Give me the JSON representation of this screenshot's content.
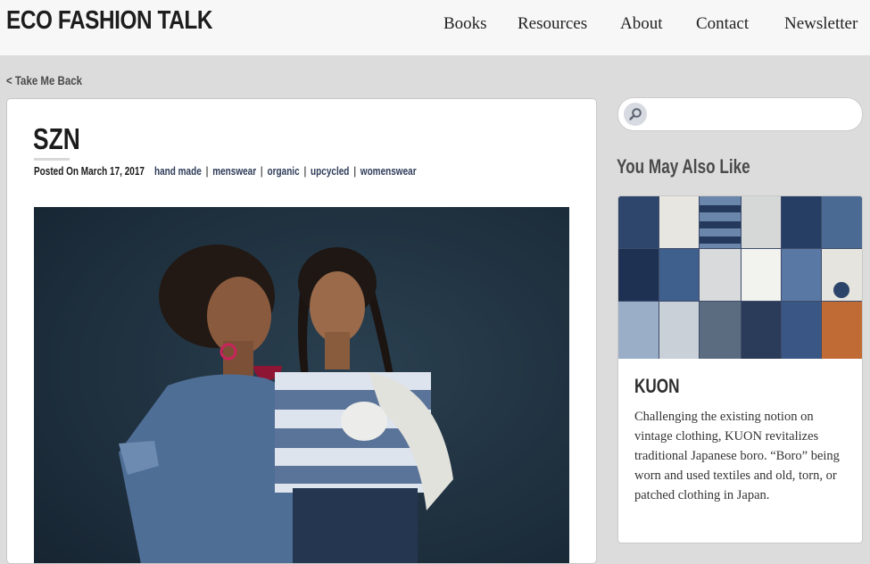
{
  "header": {
    "logo": "ECO FASHION TALK",
    "nav": [
      "Books",
      "Resources",
      "About",
      "Contact",
      "Newsletter"
    ]
  },
  "back_link": "< Take Me Back",
  "post": {
    "title": "SZN",
    "date": "Posted On March 17, 2017",
    "tags": [
      "hand made",
      "menswear",
      "organic",
      "upcycled",
      "womenswear"
    ],
    "tag_separator": "|"
  },
  "search": {
    "placeholder": "",
    "value": ""
  },
  "sidebar": {
    "heading": "You May Also Like",
    "related": {
      "title": "KUON",
      "excerpt": "Challenging the existing notion on vintage clothing, KUON revitalizes traditional Japanese boro. “Boro” being worn and used textiles and old, torn, or patched clothing in Japan."
    }
  },
  "colors": {
    "page_bg": "#dcdcdc",
    "header_bg": "#f7f7f7",
    "tag_link": "#2f3d5a",
    "photo_backdrop": "#1f3040"
  }
}
